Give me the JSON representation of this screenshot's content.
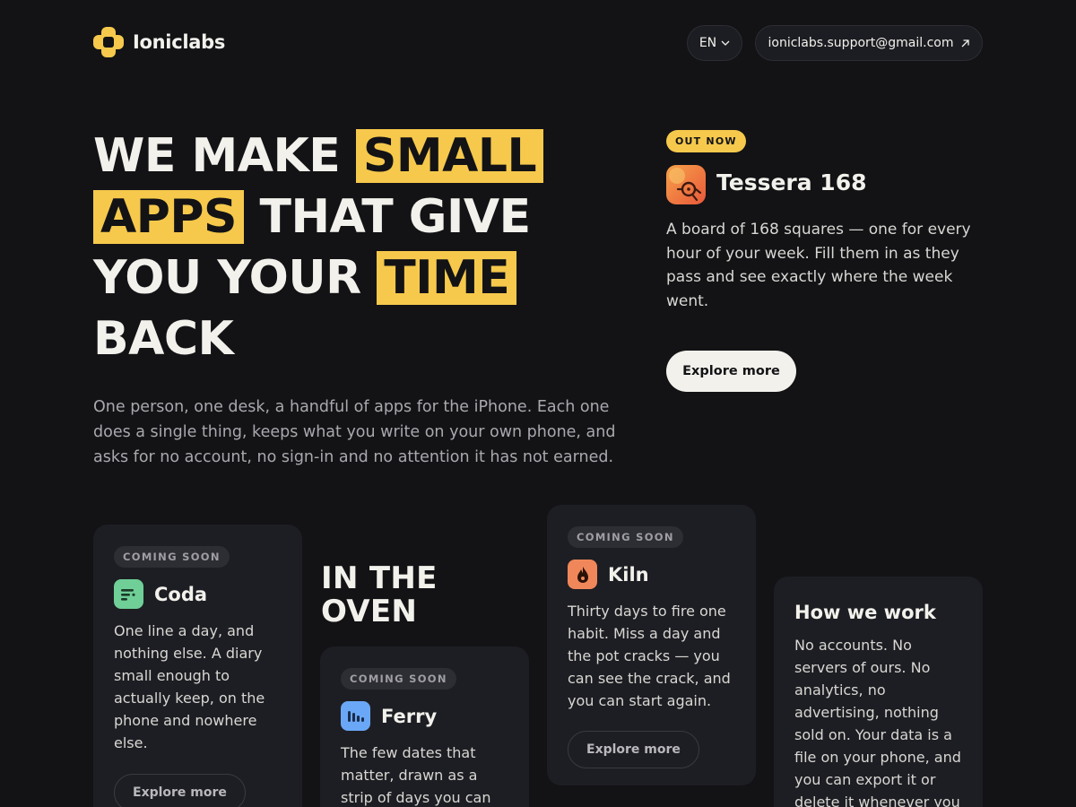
{
  "header": {
    "brand": "Ioniclabs",
    "language": "EN",
    "email": "ioniclabs.support@gmail.com"
  },
  "hero": {
    "headline_parts": [
      "WE MAKE",
      "SMALL",
      "APPS",
      "THAT GIVE",
      "YOU YOUR",
      "TIME",
      "BACK"
    ],
    "subtitle": "One person, one desk, a handful of apps for the iPhone. Each one does a single thing, keeps what you write on your own phone, and asks for no account, no sign-in and no attention it has not earned."
  },
  "featured": {
    "badge": "OUT NOW",
    "name": "Tessera 168",
    "description": "A board of 168 squares — one for every hour of your week. Fill them in as they pass and see exactly where the week went.",
    "button": "Explore more"
  },
  "oven_heading": "IN THE OVEN",
  "apps": [
    {
      "badge": "COMING SOON",
      "name": "Coda",
      "icon": "coda-icon",
      "icon_color": "#6fcf97",
      "description": "One line a day, and nothing else. A diary small enough to actually keep, on the phone and nowhere else.",
      "button": "Explore more"
    },
    {
      "badge": "COMING SOON",
      "name": "Ferry",
      "icon": "ferry-icon",
      "icon_color": "#6aa8f7",
      "description": "The few dates that matter, drawn as a strip of days you can watch"
    },
    {
      "badge": "COMING SOON",
      "name": "Kiln",
      "icon": "flame-icon",
      "icon_color": "#f0875a",
      "description": "Thirty days to fire one habit. Miss a day and the pot cracks — you can see the crack, and you can start again.",
      "button": "Explore more"
    }
  ],
  "how": {
    "title": "How we work",
    "description": "No accounts. No servers of ours. No analytics, no advertising, nothing sold on. Your data is a file on your phone, and you can export it or delete it whenever you"
  },
  "colors": {
    "background": "#131316",
    "accent": "#f6c94c",
    "card": "#1d1e23"
  }
}
